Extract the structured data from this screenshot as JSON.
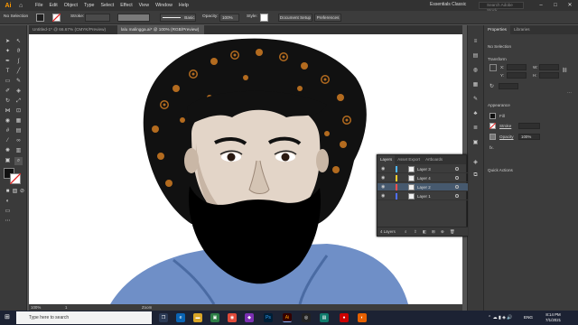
{
  "app": {
    "logo": "Ai",
    "workspace": "Essentials Classic",
    "search_placeholder": "Search Adobe Stock"
  },
  "menu": [
    "File",
    "Edit",
    "Object",
    "Type",
    "Select",
    "Effect",
    "View",
    "Window",
    "Help"
  ],
  "control": {
    "selection": "No Selection",
    "stroke_label": "Stroke:",
    "stroke_width": "",
    "brush": "Basic",
    "opacity_label": "Opacity:",
    "opacity_value": "100%",
    "style_label": "Style:",
    "doc_setup": "Document Setup",
    "preferences": "Preferences"
  },
  "doc_tabs": [
    "Untitled-1* @ 66.67% (CMYK/Preview)",
    "lalu malingga.ai* @ 100% (RGB/Preview)"
  ],
  "properties": {
    "tabs": [
      "Properties",
      "Libraries"
    ],
    "selection": "No Selection",
    "transform": "Transform",
    "x_label": "X:",
    "y_label": "Y:",
    "w_label": "W:",
    "h_label": "H:",
    "appearance": "Appearance",
    "fill_label": "Fill",
    "stroke_label": "Stroke",
    "opacity_label": "Opacity",
    "opacity_value": "100%",
    "fx": "fx.",
    "quick_actions": "Quick Actions"
  },
  "layers_panel": {
    "tabs": [
      "Layers",
      "Asset Export",
      "Artboards"
    ],
    "layers": [
      {
        "name": "Layer 3",
        "color": "#4fb7ff",
        "selected": false
      },
      {
        "name": "Layer 4",
        "color": "#ffcf2e",
        "selected": false
      },
      {
        "name": "Layer 2",
        "color": "#ff4f4f",
        "selected": true
      },
      {
        "name": "Layer 1",
        "color": "#4f6fff",
        "selected": false
      }
    ],
    "count": "4 Layers"
  },
  "status": {
    "zoom": "100%",
    "page": "1",
    "tool": "Zoom"
  },
  "taskbar": {
    "search": "Type here to search",
    "time": "8:14 PM",
    "date": "7/1/2021",
    "lang": "ENG"
  },
  "colors": {
    "accent": "#ff9a00",
    "hair_highlight": "#b36b1f",
    "shirt": "#6f8fc7"
  }
}
